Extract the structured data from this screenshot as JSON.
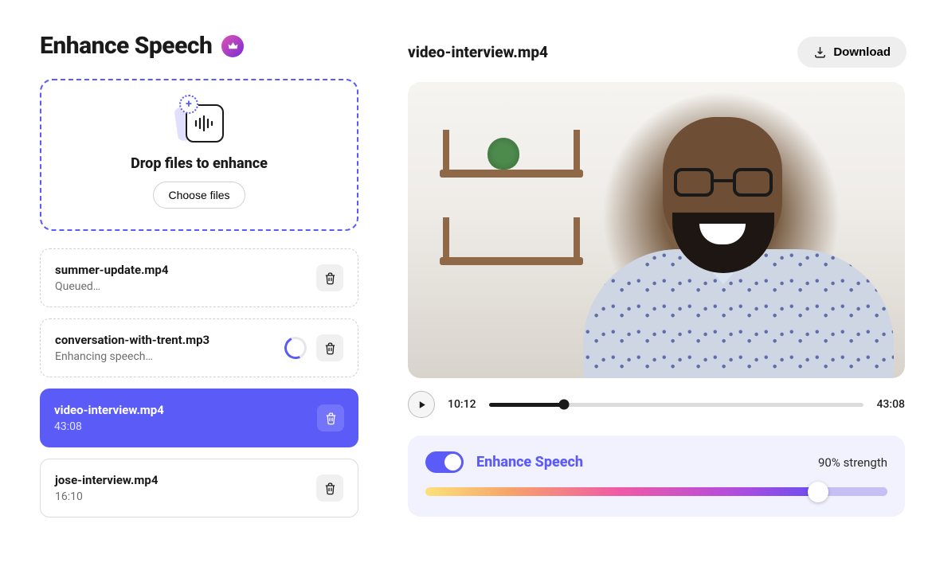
{
  "page": {
    "title": "Enhance Speech"
  },
  "dropzone": {
    "label": "Drop files to enhance",
    "button": "Choose files"
  },
  "files": [
    {
      "name": "summer-update.mp4",
      "status": "Queued…",
      "state": "queued"
    },
    {
      "name": "conversation-with-trent.mp3",
      "status": "Enhancing speech…",
      "state": "processing"
    },
    {
      "name": "video-interview.mp4",
      "status": "43:08",
      "state": "active"
    },
    {
      "name": "jose-interview.mp4",
      "status": "16:10",
      "state": "done"
    }
  ],
  "viewer": {
    "filename": "video-interview.mp4",
    "download": "Download",
    "current_time": "10:12",
    "duration": "43:08",
    "progress_pct": 20
  },
  "enhance": {
    "label": "Enhance Speech",
    "strength_label": "90% strength",
    "strength_pct": 90,
    "enabled": true
  },
  "colors": {
    "primary": "#5b5bf8",
    "panel_bg": "#f2f1fe"
  }
}
